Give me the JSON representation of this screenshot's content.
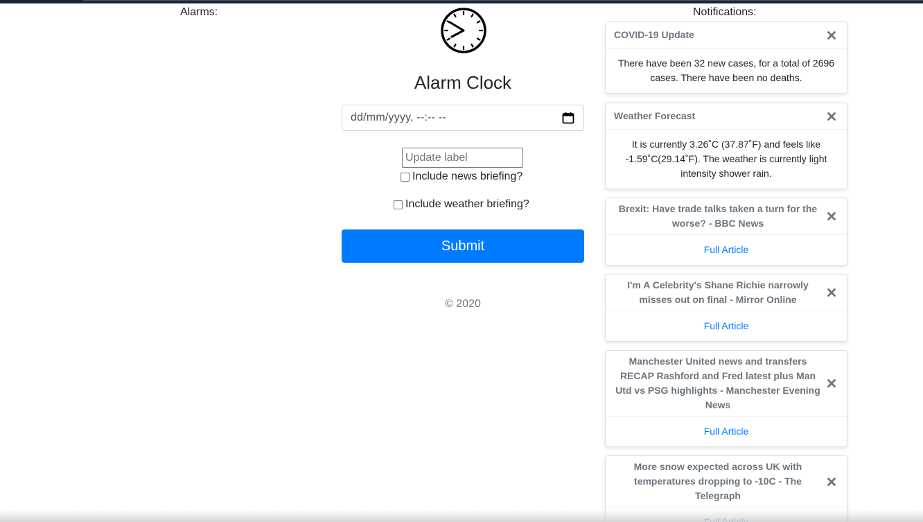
{
  "alarms": {
    "label": "Alarms:"
  },
  "notifications": {
    "label": "Notifications:",
    "items": [
      {
        "title": "COVID-19 Update",
        "body": "There have been 32 new cases, for a total of 2696 cases. There have been no deaths.",
        "close_icon": "close-icon"
      },
      {
        "title": "Weather Forecast",
        "body": "It is currently 3.26˚C (37.87˚F) and feels like -1.59˚C(29.14˚F). The weather is currently light intensity shower rain.",
        "close_icon": "close-icon"
      },
      {
        "title": "Brexit: Have trade talks taken a turn for the worse? - BBC News",
        "link": "Full Article",
        "close_icon": "close-icon"
      },
      {
        "title": "I'm A Celebrity's Shane Richie narrowly misses out on final - Mirror Online",
        "link": "Full Article",
        "close_icon": "close-icon"
      },
      {
        "title": "Manchester United news and transfers RECAP Rashford and Fred latest plus Man Utd vs PSG highlights - Manchester Evening News",
        "link": "Full Article",
        "close_icon": "close-icon"
      },
      {
        "title": "More snow expected across UK with temperatures dropping to -10C - The Telegraph",
        "link": "Full Article",
        "close_icon": "close-icon"
      }
    ]
  },
  "main": {
    "clock_icon": "clock-icon",
    "title": "Alarm Clock",
    "datetime_placeholder": "dd/mm/yyyy, --:-- --",
    "calendar_icon": "calendar-icon",
    "label_placeholder": "Update label",
    "news_checkbox": {
      "label": "Include news briefing?",
      "checked": false
    },
    "weather_checkbox": {
      "label": "Include weather briefing?",
      "checked": false
    },
    "submit_label": "Submit",
    "footer": "© 2020"
  },
  "colors": {
    "primary": "#007bff",
    "muted": "#6c757d",
    "text": "#212529",
    "topbar": "#1b2432"
  }
}
